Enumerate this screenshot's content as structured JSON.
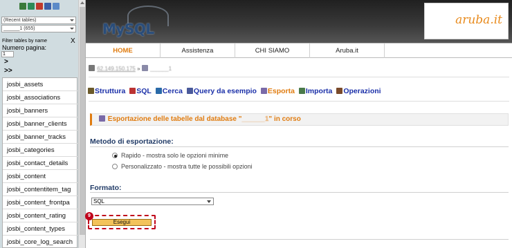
{
  "sidebar": {
    "recent_tables": "(Recent tables)",
    "database": "______1 (655)",
    "filter_label": "Filter tables by name",
    "filter_clear": "X",
    "numero_pagina_label": "Numero pagina:",
    "page_value": "1",
    "nav_next": ">",
    "nav_last": ">>",
    "tables": [
      "josbi_assets",
      "josbi_associations",
      "josbi_banners",
      "josbi_banner_clients",
      "josbi_banner_tracks",
      "josbi_categories",
      "josbi_contact_details",
      "josbi_content",
      "josbi_contentitem_tag",
      "josbi_content_frontpa",
      "josbi_content_rating",
      "josbi_content_types",
      "josbi_core_log_search"
    ]
  },
  "header": {
    "mysql_logo": "MySQL",
    "aruba_logo": "aruba.it"
  },
  "nav": {
    "tabs": [
      "HOME",
      "Assistenza",
      "CHI SIAMO",
      "Aruba.it"
    ]
  },
  "breadcrumb": {
    "host": "62.149.150.175",
    "sep": " » ",
    "db": "______1"
  },
  "toolbar": {
    "items": [
      "Struttura",
      "SQL",
      "Cerca",
      "Query da esempio",
      "Esporta",
      "Importa",
      "Operazioni"
    ]
  },
  "banner": {
    "prefix": "Esportazione delle tabelle dal database \"",
    "db": "______1",
    "suffix": "\" in corso"
  },
  "export": {
    "metodo_title": "Metodo di esportazione:",
    "option_rapido": "Rapido - mostra solo le opzioni minime",
    "option_personalizzato": "Personalizzato - mostra tutte le possibili opzioni",
    "formato_title": "Formato:",
    "formato_value": "SQL",
    "esegui_label": "Esegui",
    "step_badge": "9"
  },
  "colors": {
    "accent": "#e07c10",
    "link": "#1a2fa8",
    "heading": "#203a66",
    "callout": "#c0001a"
  }
}
